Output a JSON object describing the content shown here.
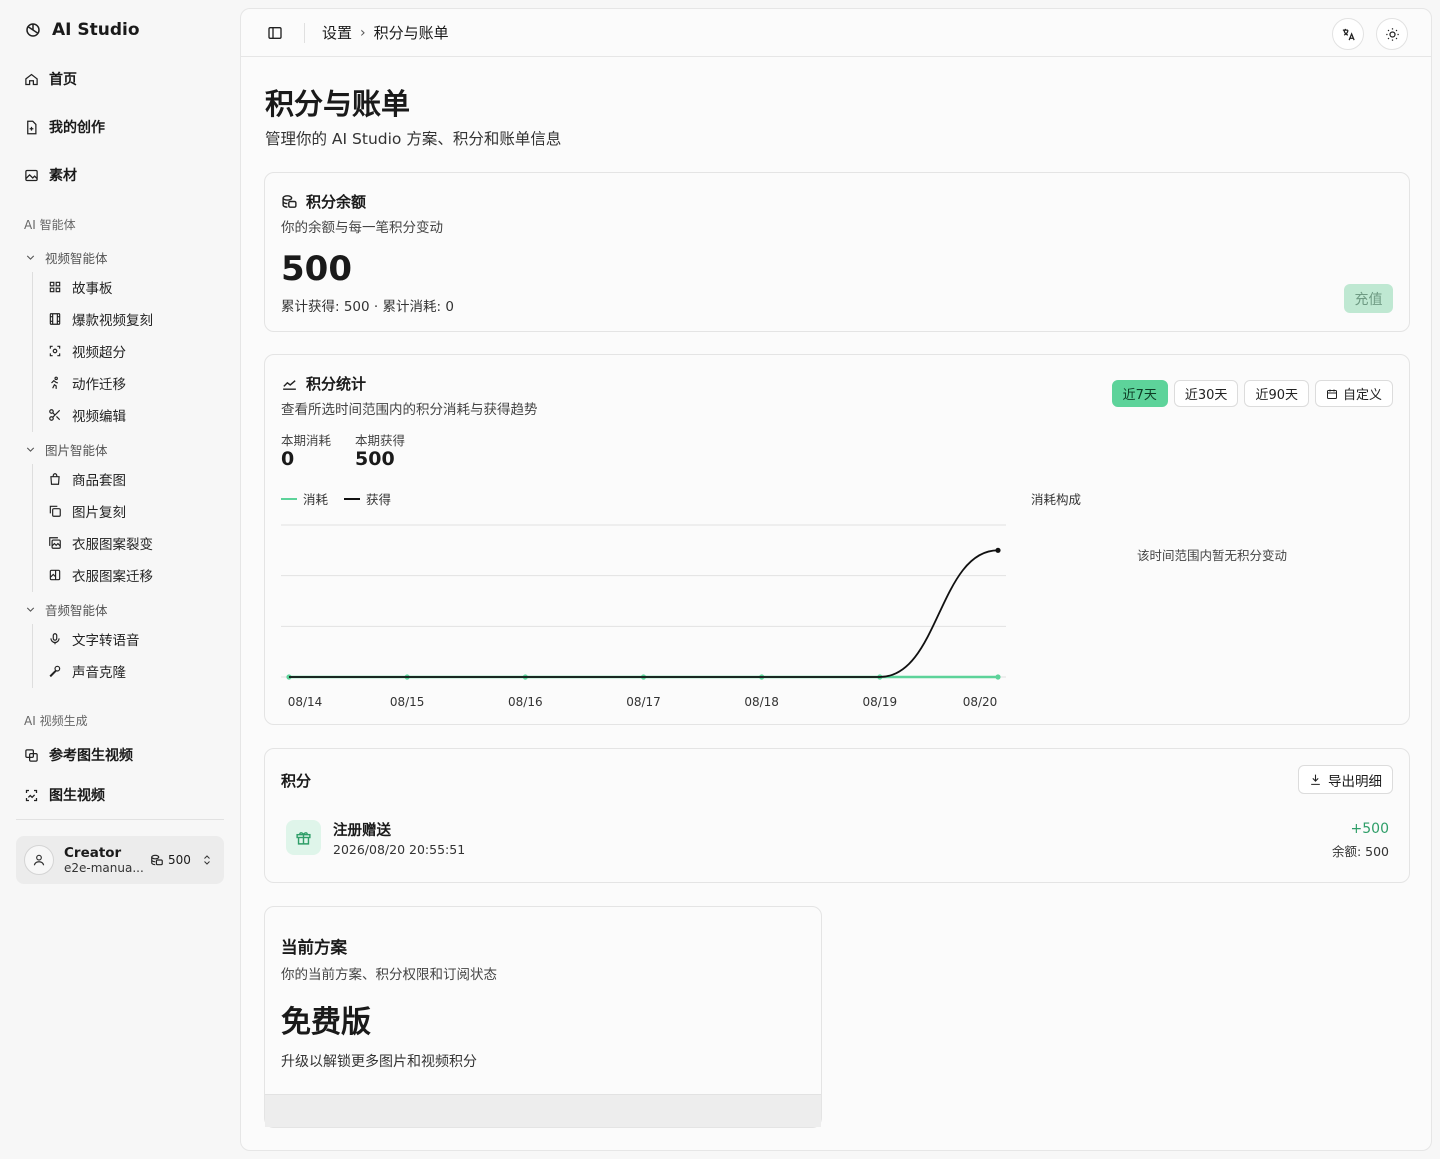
{
  "brand": {
    "name": "AI Studio",
    "icon": "openai-logo-icon"
  },
  "sidebar": {
    "top_items": [
      {
        "label": "首页",
        "icon": "home-icon"
      },
      {
        "label": "我的创作",
        "icon": "file-plus-icon"
      },
      {
        "label": "素材",
        "icon": "image-icon"
      }
    ],
    "section_agents": "AI 智能体",
    "groups": [
      {
        "label": "视频智能体",
        "items": [
          {
            "label": "故事板",
            "icon": "grid-icon"
          },
          {
            "label": "爆款视频复刻",
            "icon": "film-icon"
          },
          {
            "label": "视频超分",
            "icon": "scan-icon"
          },
          {
            "label": "动作迁移",
            "icon": "running-icon"
          },
          {
            "label": "视频编辑",
            "icon": "scissors-icon"
          }
        ]
      },
      {
        "label": "图片智能体",
        "items": [
          {
            "label": "商品套图",
            "icon": "shopping-bag-icon"
          },
          {
            "label": "图片复刻",
            "icon": "copy-icon"
          },
          {
            "label": "衣服图案裂变",
            "icon": "image-split-icon"
          },
          {
            "label": "衣服图案迁移",
            "icon": "image-transfer-icon"
          }
        ]
      },
      {
        "label": "音频智能体",
        "items": [
          {
            "label": "文字转语音",
            "icon": "microphone-icon"
          },
          {
            "label": "声音克隆",
            "icon": "mic-clone-icon"
          }
        ]
      }
    ],
    "section_video_gen": "AI 视频生成",
    "video_gen_items": [
      {
        "label": "参考图生视频",
        "icon": "image-video-icon"
      },
      {
        "label": "图生视频",
        "icon": "scan-video-icon"
      }
    ],
    "user": {
      "name": "Creator",
      "email": "e2e-manua...",
      "credits": "500"
    }
  },
  "topbar": {
    "breadcrumb_parent": "设置",
    "breadcrumb_current": "积分与账单",
    "translate_icon": "translate-icon",
    "theme_icon": "sun-icon"
  },
  "page": {
    "title": "积分与账单",
    "subtitle": "管理你的 AI Studio 方案、积分和账单信息"
  },
  "balance_card": {
    "title": "积分余额",
    "desc": "你的余额与每一笔积分变动",
    "balance": "500",
    "meta": "累计获得: 500 · 累计消耗: 0",
    "recharge": "充值"
  },
  "stats_card": {
    "title": "积分统计",
    "desc": "查看所选时间范围内的积分消耗与获得趋势",
    "ranges": [
      "近7天",
      "近30天",
      "近90天",
      "自定义"
    ],
    "active_range": 0,
    "consumed_label": "本期消耗",
    "consumed_value": "0",
    "earned_label": "本期获得",
    "earned_value": "500",
    "compose_title": "消耗构成",
    "compose_empty": "该时间范围内暂无积分变动"
  },
  "chart_data": {
    "type": "line",
    "x": [
      "08/14",
      "08/15",
      "08/16",
      "08/17",
      "08/18",
      "08/19",
      "08/20"
    ],
    "series": [
      {
        "name": "消耗",
        "values": [
          0,
          0,
          0,
          0,
          0,
          0,
          0
        ],
        "color": "#5dd39a"
      },
      {
        "name": "获得",
        "values": [
          0,
          0,
          0,
          0,
          0,
          0,
          500
        ],
        "color": "#111111"
      }
    ],
    "ylim": [
      0,
      600
    ],
    "grid": true,
    "legend": "top-left"
  },
  "transactions_card": {
    "title": "积分",
    "export": "导出明细",
    "items": [
      {
        "title": "注册赠送",
        "time": "2026/08/20 20:55:51",
        "amount": "+500",
        "balance": "余额: 500",
        "icon": "gift-icon"
      }
    ]
  },
  "plan_card": {
    "title": "当前方案",
    "desc": "你的当前方案、积分权限和订阅状态",
    "plan": "免费版",
    "hint": "升级以解锁更多图片和视频积分"
  }
}
